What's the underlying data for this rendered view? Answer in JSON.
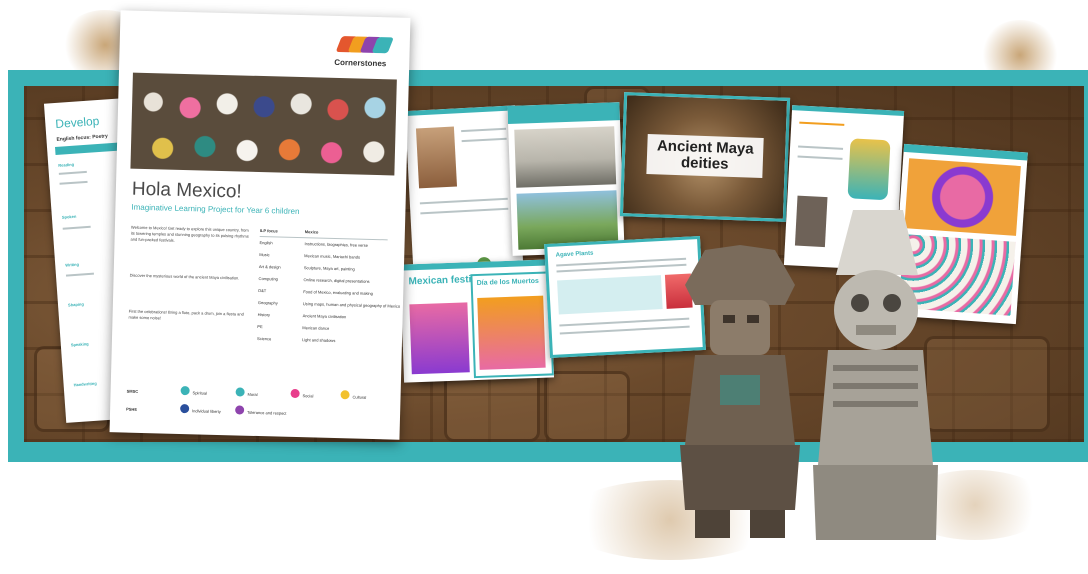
{
  "brand": {
    "name": "Cornerstones",
    "colors": {
      "teal": "#3bb3b7",
      "logo": [
        "#e4572e",
        "#f29e1f",
        "#8e44ad",
        "#3bb3b7"
      ]
    }
  },
  "project_doc": {
    "title": "Hola Mexico!",
    "subtitle": "Imaginative Learning Project for Year 6 children",
    "intro": [
      "Welcome to Mexico! Get ready to explore this unique country, from its towering temples and stunning geography to its pulsing rhythms and fun-packed festivals.",
      "Discover the mysterious world of the ancient Maya civilisation.",
      "First the celebrations! Bring a flute, pack a drum, join a fiesta and make some noise!"
    ],
    "table_header": [
      "ILP focus",
      "Mexico"
    ],
    "subjects": [
      "English",
      "Music",
      "Art & design",
      "Computing",
      "D&T",
      "Geography",
      "History",
      "PE",
      "Science"
    ],
    "details": [
      "Instructions, biographies, free verse",
      "Mexican music, Mariachi bands",
      "Sculpture, Maya art, painting",
      "Online research, digital presentations",
      "Food of Mexico, evaluating and making",
      "Using maps, human and physical geography of Mexico",
      "Ancient Maya civilisation",
      "Mexican dance",
      "Light and shadows"
    ],
    "smsc_label": "SMSC",
    "pshe_label": "PSHE",
    "smsc": [
      "Spiritual",
      "Moral",
      "Social",
      "Cultural"
    ],
    "pshe": [
      "Individual liberty",
      "Tolerance and respect"
    ]
  },
  "develop_doc": {
    "heading": "Develop",
    "subheading": "English focus: Poetry",
    "sections": [
      "Reading",
      "Spoken",
      "Writing",
      "Shaping",
      "Speaking",
      "Handwriting"
    ]
  },
  "slides": {
    "maya_deities_title": "Ancient Maya deities",
    "festivals_title": "Mexican festivals",
    "dia_de_muertos_title": "Día de los Muertos",
    "agave_title": "Agave Plants"
  }
}
